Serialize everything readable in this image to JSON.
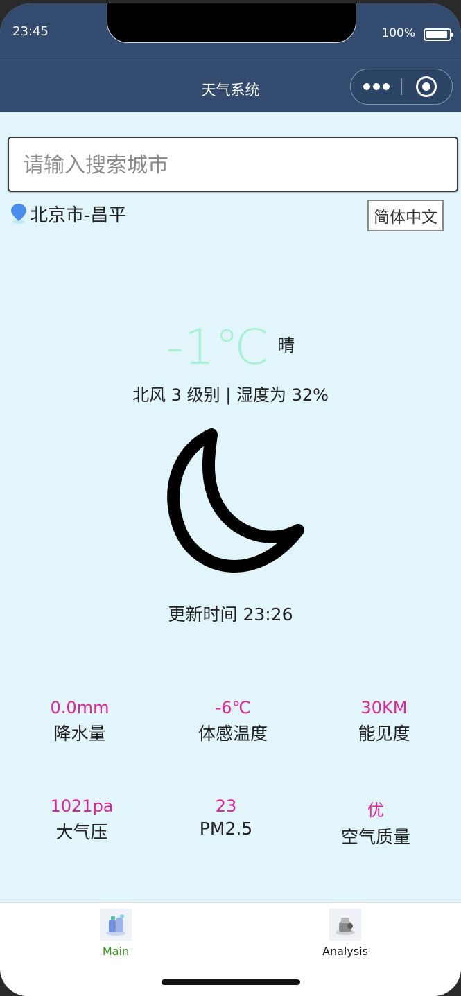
{
  "status": {
    "time": "23:45",
    "battery": "100%"
  },
  "nav": {
    "title": "天气系统"
  },
  "search": {
    "placeholder": "请输入搜索城市"
  },
  "location": {
    "name": "北京市-昌平"
  },
  "language_button": "简体中文",
  "weather": {
    "temperature": "-1℃",
    "condition": "晴",
    "wind_humidity": "北风 3 级别 | 湿度为 32%",
    "icon": "crescent-moon-icon",
    "updated": "更新时间 23:26"
  },
  "metrics": [
    {
      "value": "0.0mm",
      "label": "降水量"
    },
    {
      "value": "-6℃",
      "label": "体感温度"
    },
    {
      "value": "30KM",
      "label": "能见度"
    },
    {
      "value": "1021pa",
      "label": "大气压"
    },
    {
      "value": "23",
      "label": "PM2.5"
    },
    {
      "value": "优",
      "label": "空气质量"
    }
  ],
  "tabs": [
    {
      "label": "Main",
      "color": "#3a9c1f",
      "icon": "main-tab-icon"
    },
    {
      "label": "Analysis",
      "color": "#111111",
      "icon": "analysis-tab-icon"
    }
  ],
  "colors": {
    "header": "#324b6e",
    "background": "#e2f5fa",
    "temperature": "#a8f0d4",
    "metric_value": "#e0239a"
  }
}
